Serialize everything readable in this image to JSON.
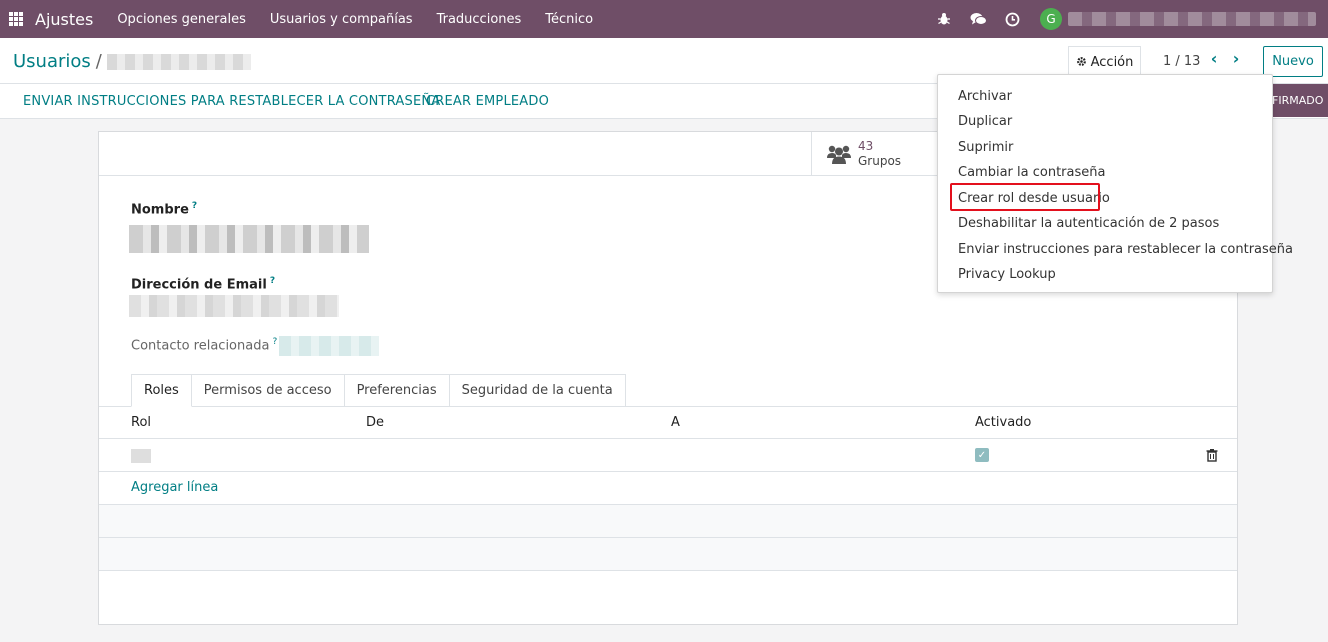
{
  "navbar": {
    "brand": "Ajustes",
    "menu": [
      "Opciones generales",
      "Usuarios y compañías",
      "Traducciones",
      "Técnico"
    ],
    "avatar_letter": "G",
    "icons": [
      "bug-icon",
      "chat-icon",
      "clock-icon"
    ]
  },
  "control": {
    "breadcrumb_root": "Usuarios",
    "breadcrumb_sep": "/",
    "action_label": "Acción",
    "pager": "1 / 13",
    "new_label": "Nuevo"
  },
  "statusbar": {
    "links": [
      "ENVIAR INSTRUCCIONES PARA RESTABLECER LA CONTRASEÑA",
      "CREAR EMPLEADO"
    ],
    "status": "FIRMADO"
  },
  "smart_button": {
    "value": "43",
    "label": "Grupos"
  },
  "fields": {
    "name_label": "Nombre",
    "email_label": "Dirección de Email",
    "contact_label": "Contacto relacionada",
    "help_mark": "?"
  },
  "tabs": [
    "Roles",
    "Permisos de acceso",
    "Preferencias",
    "Seguridad de la cuenta"
  ],
  "table": {
    "columns": [
      "Rol",
      "De",
      "A",
      "Activado"
    ],
    "add_line": "Agregar línea",
    "check_mark": "✓"
  },
  "dropdown": {
    "items": [
      "Archivar",
      "Duplicar",
      "Suprimir",
      "Cambiar la contraseña",
      "Crear rol desde usuario",
      "Deshabilitar la autenticación de 2 pasos",
      "Enviar instrucciones para restablecer la contraseña",
      "Privacy Lookup"
    ],
    "highlighted_index": 4
  },
  "colors": {
    "navbar": "#6f4e67",
    "primary": "#017e84",
    "highlight_border": "#e3101d"
  }
}
